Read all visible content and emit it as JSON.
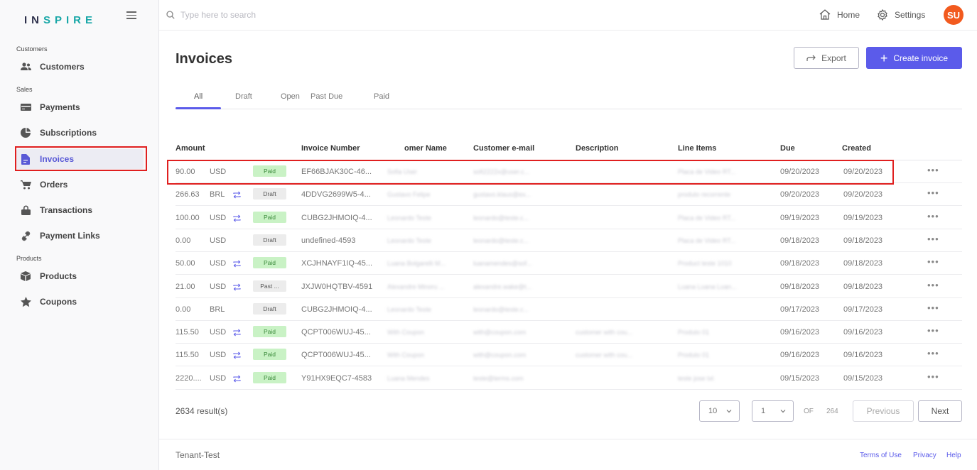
{
  "brand": {
    "part1": "IN",
    "part2": "SPIRE"
  },
  "sidebar": {
    "groups": {
      "customers": "Customers",
      "sales": "Sales",
      "products": "Products"
    },
    "items": [
      {
        "label": "Customers",
        "icon": "users-icon"
      },
      {
        "label": "Payments",
        "icon": "card-icon"
      },
      {
        "label": "Subscriptions",
        "icon": "pie-icon"
      },
      {
        "label": "Invoices",
        "icon": "file-icon",
        "active": true
      },
      {
        "label": "Orders",
        "icon": "cart-icon"
      },
      {
        "label": "Transactions",
        "icon": "lock-icon"
      },
      {
        "label": "Payment Links",
        "icon": "link-icon"
      },
      {
        "label": "Products",
        "icon": "box-icon"
      },
      {
        "label": "Coupons",
        "icon": "star-icon"
      }
    ]
  },
  "topbar": {
    "search_placeholder": "Type here to search",
    "home_label": "Home",
    "settings_label": "Settings",
    "avatar_initials": "SU"
  },
  "main": {
    "title": "Invoices",
    "export_label": "Export",
    "create_label": "Create invoice",
    "tabs": [
      "All",
      "Draft",
      "Open",
      "Past Due",
      "Paid"
    ]
  },
  "table": {
    "headers": [
      "Amount",
      "Invoice Number",
      "omer Name",
      "Customer e-mail",
      "Description",
      "Line Items",
      "Due",
      "Created"
    ],
    "rows": [
      {
        "amount": "90.00",
        "currency": "USD",
        "recurring": false,
        "status": "Paid",
        "status_type": "paid",
        "invoice": "EF66BJAK30C-46...",
        "name": "Sofia User",
        "email": "sofi2222x@user.c...",
        "description": "",
        "items": "Placa de Video RT...",
        "due": "09/20/2023",
        "created": "09/20/2023"
      },
      {
        "amount": "266.63",
        "currency": "BRL",
        "recurring": true,
        "status": "Draft",
        "status_type": "draft",
        "invoice": "4DDVG2699W5-4...",
        "name": "Gustavo Felipe",
        "email": "gustavo.klaus@ex...",
        "description": "",
        "items": "produto recorrente",
        "due": "09/20/2023",
        "created": "09/20/2023"
      },
      {
        "amount": "100.00",
        "currency": "USD",
        "recurring": true,
        "status": "Paid",
        "status_type": "paid",
        "invoice": "CUBG2JHMOIQ-4...",
        "name": "Leonardo Teste",
        "email": "leonardo@teste.c...",
        "description": "",
        "items": "Placa de Video RT...",
        "due": "09/19/2023",
        "created": "09/19/2023"
      },
      {
        "amount": "0.00",
        "currency": "USD",
        "recurring": false,
        "status": "Draft",
        "status_type": "draft",
        "invoice": "undefined-4593",
        "name": "Leonardo Teste",
        "email": "leonardo@teste.c...",
        "description": "",
        "items": "Placa de Video RT...",
        "due": "09/18/2023",
        "created": "09/18/2023"
      },
      {
        "amount": "50.00",
        "currency": "USD",
        "recurring": true,
        "status": "Paid",
        "status_type": "paid",
        "invoice": "XCJHNAYF1IQ-45...",
        "name": "Luana Bolgarelli M...",
        "email": "luanamendes@sof...",
        "description": "",
        "items": "Product teste 1010",
        "due": "09/18/2023",
        "created": "09/18/2023"
      },
      {
        "amount": "21.00",
        "currency": "USD",
        "recurring": true,
        "status": "Past ...",
        "status_type": "past",
        "invoice": "JXJW0HQTBV-4591",
        "name": "Alexandre Minoru ...",
        "email": "alexandre.wake@t...",
        "description": "",
        "items": "Luana Luana Luan...",
        "due": "09/18/2023",
        "created": "09/18/2023"
      },
      {
        "amount": "0.00",
        "currency": "BRL",
        "recurring": false,
        "status": "Draft",
        "status_type": "draft",
        "invoice": "CUBG2JHMOIQ-4...",
        "name": "Leonardo Teste",
        "email": "leonardo@teste.c...",
        "description": "",
        "items": "",
        "due": "09/17/2023",
        "created": "09/17/2023"
      },
      {
        "amount": "115.50",
        "currency": "USD",
        "recurring": true,
        "status": "Paid",
        "status_type": "paid",
        "invoice": "QCPT006WUJ-45...",
        "name": "With Coupon",
        "email": "with@coupon.com",
        "description": "customer with cou...",
        "items": "Produto 01",
        "due": "09/16/2023",
        "created": "09/16/2023"
      },
      {
        "amount": "115.50",
        "currency": "USD",
        "recurring": true,
        "status": "Paid",
        "status_type": "paid",
        "invoice": "QCPT006WUJ-45...",
        "name": "With Coupon",
        "email": "with@coupon.com",
        "description": "customer with cou...",
        "items": "Produto 01",
        "due": "09/16/2023",
        "created": "09/16/2023"
      },
      {
        "amount": "2220....",
        "currency": "USD",
        "recurring": true,
        "status": "Paid",
        "status_type": "paid",
        "invoice": "Y91HX9EQC7-4583",
        "name": "Luana Mendes",
        "email": "teste@terms.com",
        "description": "",
        "items": "teste jose txt",
        "due": "09/15/2023",
        "created": "09/15/2023"
      }
    ]
  },
  "pagination": {
    "results": "2634 result(s)",
    "page_size": "10",
    "page": "1",
    "of_label": "OF",
    "total_pages": "264",
    "prev_label": "Previous",
    "next_label": "Next"
  },
  "footer": {
    "tenant": "Tenant-Test",
    "terms": "Terms of Use",
    "privacy": "Privacy",
    "help": "Help"
  },
  "colors": {
    "accent": "#5b5bea",
    "highlight": "#e01f1f",
    "avatar": "#f25a1e",
    "paid_bg": "#c9f2c5"
  }
}
